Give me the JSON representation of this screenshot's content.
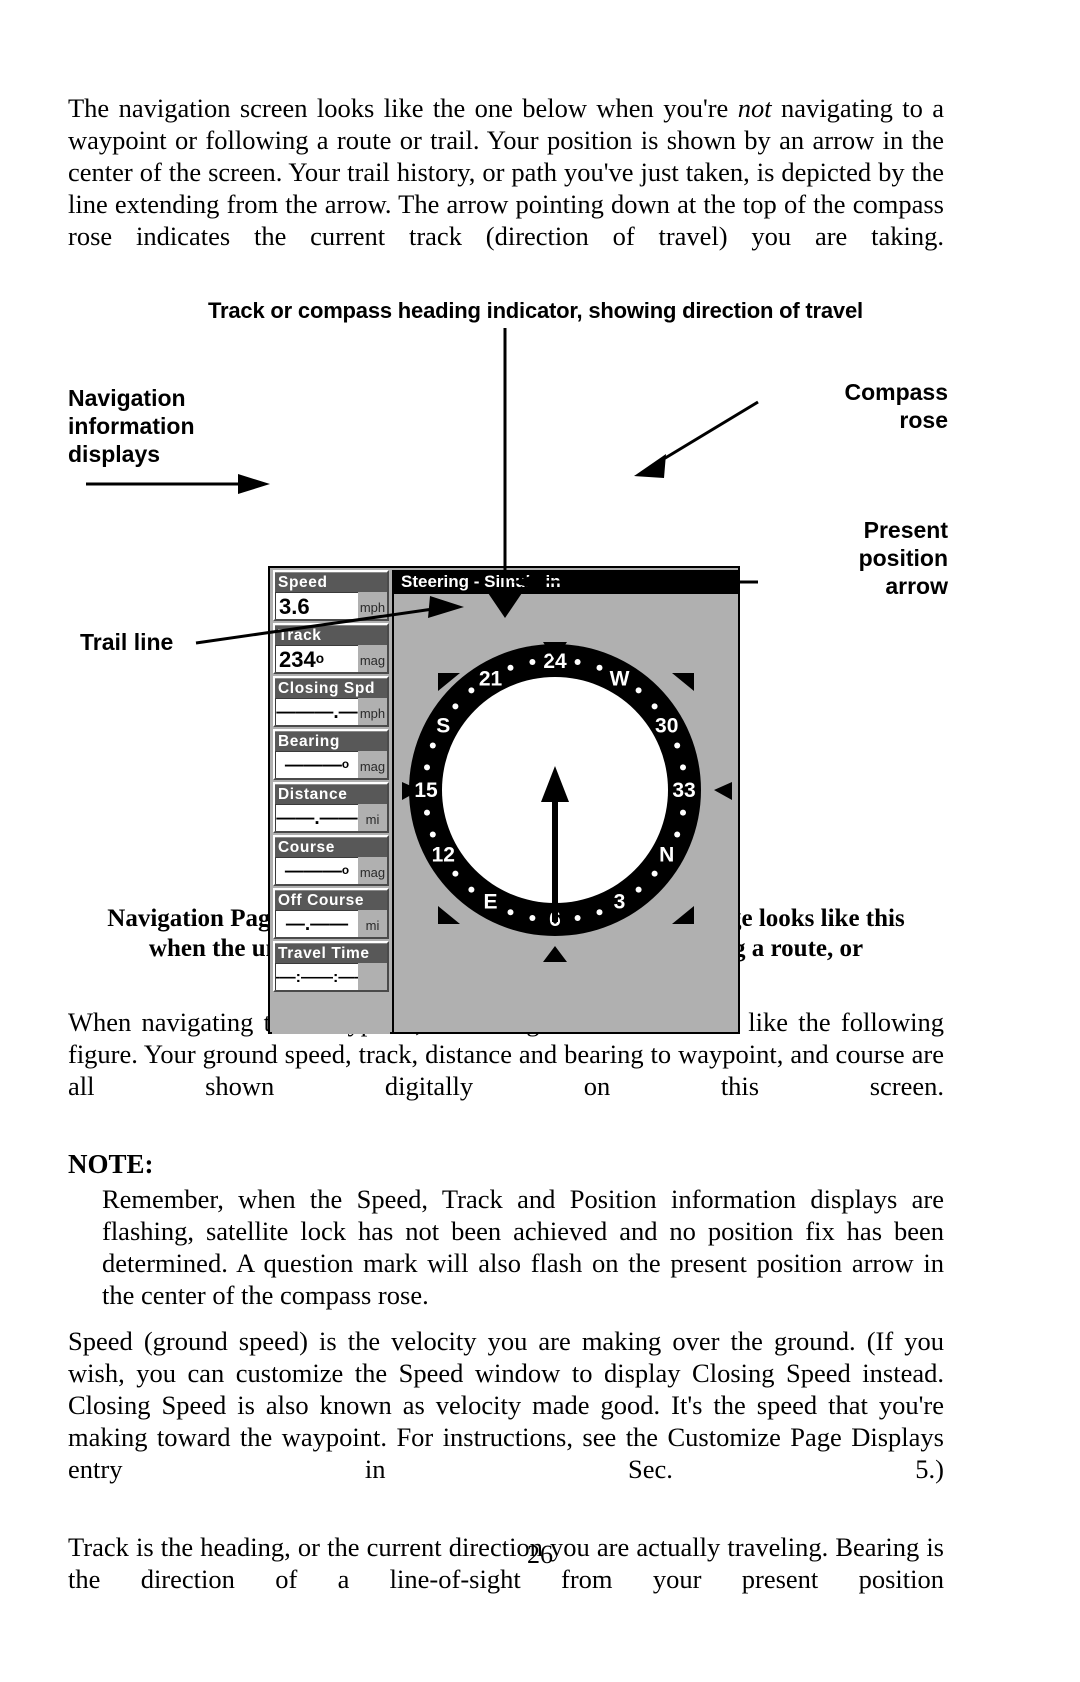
{
  "page": {
    "number": "26"
  },
  "paragraphs": {
    "intro_pre": "The navigation screen looks like the one below when you're ",
    "intro_ital": "not",
    "intro_post": " navigating to a waypoint or following a route or trail. Your position is shown by an arrow in the center of the screen. Your trail history, or path you've just taken, is depicted by the line extending from the arrow. The arrow pointing down at the top of the compass rose indicates the current track (direction of travel) you are taking.",
    "after_figure": "When navigating to a waypoint, the Navigation screen looks like the following figure. Your ground speed, track, distance and bearing to waypoint, and course are all shown digitally on this screen.",
    "speed_para": "Speed (ground speed) is the velocity you are making over the ground. (If you wish, you can customize the Speed window to display Closing Speed instead. Closing Speed is also known as velocity made good. It's the speed that you're making toward the waypoint. For instructions, see the Customize Page Displays entry in Sec. 5.)",
    "track_para": "Track is the heading, or the current direction you are actually traveling. Bearing is the direction of a line-of-sight from your present position"
  },
  "note": {
    "heading": "NOTE:",
    "body": "Remember, when the Speed, Track and Position information displays are flashing, satellite lock has not been achieved and no position fix has been determined. A question mark will also flash on the present position arrow in the center of the compass rose."
  },
  "figure": {
    "title": "Track or compass heading indicator, showing direction of travel",
    "caption": "Navigation Page, recording a trail, traveling southwest. Page looks like this when the unit is not navigating to a waypoint , following a route, or backtracking a trail.",
    "callouts": {
      "nav_info_displays": "Navigation\ninformation\ndisplays",
      "nav_info_l1": "Navigation",
      "nav_info_l2": "information",
      "nav_info_l3": "displays",
      "trail_line": "Trail line",
      "compass_rose_l1": "Compass",
      "compass_rose_l2": "rose",
      "present_position_l1": "Present",
      "present_position_l2": "position",
      "present_position_l3": "arrow"
    }
  },
  "device": {
    "titlebar": "Steering - Simulatin",
    "data_boxes": [
      {
        "label": "Speed",
        "value": "3.6",
        "unit": "mph",
        "style": "num"
      },
      {
        "label": "Track",
        "value": "234º",
        "unit": "mag",
        "style": "num"
      },
      {
        "label": "Closing Spd",
        "value": "———.—",
        "unit": "mph",
        "style": "dashes"
      },
      {
        "label": "Bearing",
        "value": "———º",
        "unit": "mag",
        "style": "dashes"
      },
      {
        "label": "Distance",
        "value": "——.——",
        "unit": "mi",
        "style": "dashes"
      },
      {
        "label": "Course",
        "value": "———º",
        "unit": "mag",
        "style": "dashes"
      },
      {
        "label": "Off Course",
        "value": "—.——",
        "unit": "mi",
        "style": "dashes"
      },
      {
        "label": "Travel Time",
        "value": "——:——:——",
        "unit": "",
        "style": "dashes-small"
      }
    ],
    "compass": {
      "tick_labels": [
        "24",
        "W",
        "30",
        "33",
        "N",
        "3",
        "6",
        "E",
        "12",
        "15",
        "S",
        "21"
      ],
      "heading_top": "24",
      "colors": {
        "screen_bg": "#b0b0b0",
        "ring": "#000000",
        "inner": "#ffffff",
        "titlebar": "#000000"
      }
    }
  },
  "colors": {
    "text": "#000000",
    "paper": "#ffffff",
    "lcd_gray": "#b0b0b0",
    "label_gray": "#585858"
  }
}
